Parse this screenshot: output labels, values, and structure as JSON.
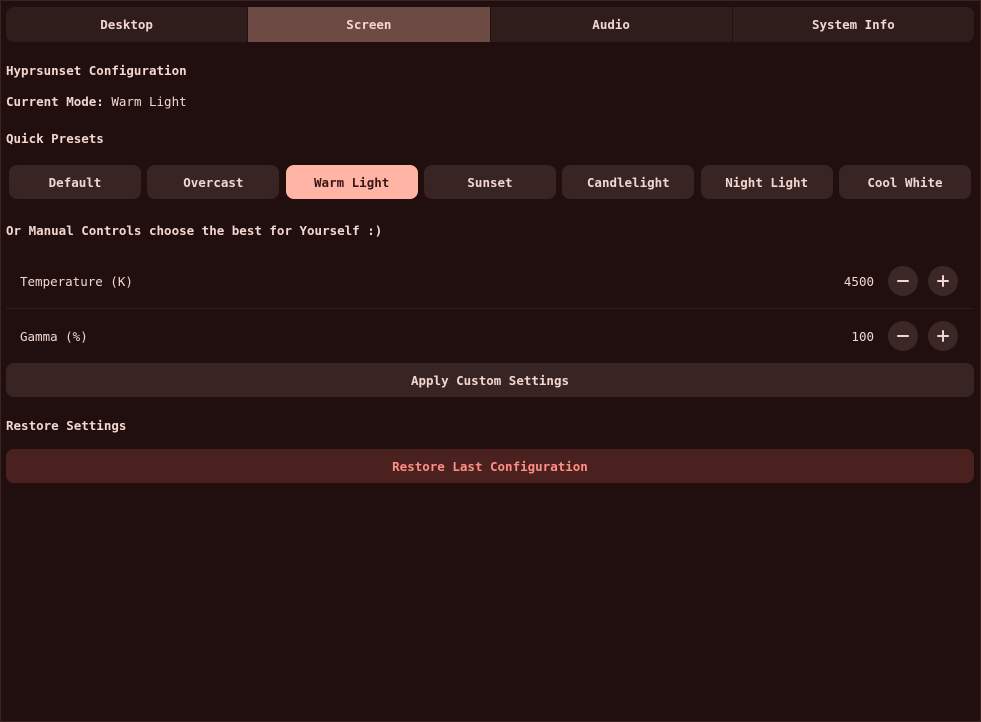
{
  "tabs": [
    {
      "label": "Desktop",
      "active": false
    },
    {
      "label": "Screen",
      "active": true
    },
    {
      "label": "Audio",
      "active": false
    },
    {
      "label": "System Info",
      "active": false
    }
  ],
  "section": {
    "title": "Hyprsunset Configuration",
    "current_mode_label": "Current Mode:",
    "current_mode_value": "Warm Light",
    "quick_presets_title": "Quick Presets",
    "manual_title": "Or Manual Controls choose the best for Yourself :)",
    "restore_title": "Restore Settings"
  },
  "presets": [
    {
      "label": "Default"
    },
    {
      "label": "Overcast"
    },
    {
      "label": "Warm Light",
      "active": true
    },
    {
      "label": "Sunset"
    },
    {
      "label": "Candlelight"
    },
    {
      "label": "Night Light"
    },
    {
      "label": "Cool White"
    }
  ],
  "controls": {
    "temperature": {
      "label": "Temperature (K)",
      "value": "4500"
    },
    "gamma": {
      "label": "Gamma (%)",
      "value": "100"
    }
  },
  "buttons": {
    "apply": "Apply Custom Settings",
    "restore": "Restore Last Configuration"
  },
  "colors": {
    "background": "#200f0e",
    "active_preset": "#ffb4a6",
    "active_tab": "#6e4a44",
    "restore_text": "#ff8f84"
  }
}
